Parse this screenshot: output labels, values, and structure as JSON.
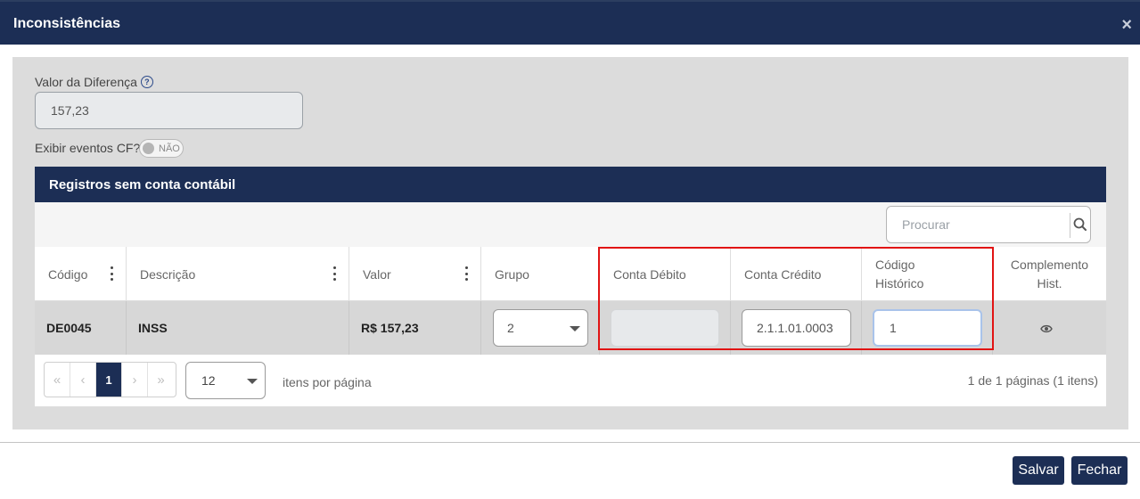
{
  "modal": {
    "title": "Inconsistências",
    "close_icon": "×"
  },
  "form": {
    "diff_label": "Valor da Diferença",
    "help_glyph": "?",
    "diff_value": "157,23",
    "cf_label": "Exibir eventos CF?",
    "cf_toggle_text": "NÃO"
  },
  "grid": {
    "title": "Registros sem conta contábil",
    "search_placeholder": "Procurar",
    "columns": {
      "codigo": "Código",
      "descricao": "Descrição",
      "valor": "Valor",
      "grupo": "Grupo",
      "conta_debito": "Conta Débito",
      "conta_credito": "Conta Crédito",
      "codigo_historico_1": "Código",
      "codigo_historico_2": "Histórico",
      "complemento_1": "Complemento",
      "complemento_2": "Hist."
    },
    "row": {
      "codigo": "DE0045",
      "descricao": "INSS",
      "valor": "R$ 157,23",
      "grupo": "2",
      "conta_debito": "",
      "conta_credito": "2.1.1.01.0003",
      "codigo_historico": "1"
    }
  },
  "pagination": {
    "first": "«",
    "prev": "‹",
    "current_page": "1",
    "next": "›",
    "last": "»",
    "page_size": "12",
    "per_page_label": "itens por página",
    "info": "1 de 1 páginas (1 itens)"
  },
  "footer": {
    "save_label": "Salvar",
    "close_label": "Fechar"
  },
  "colors": {
    "navy": "#1c2e55",
    "highlight_red": "#e11414",
    "panel_gray": "#dcdcdc"
  }
}
